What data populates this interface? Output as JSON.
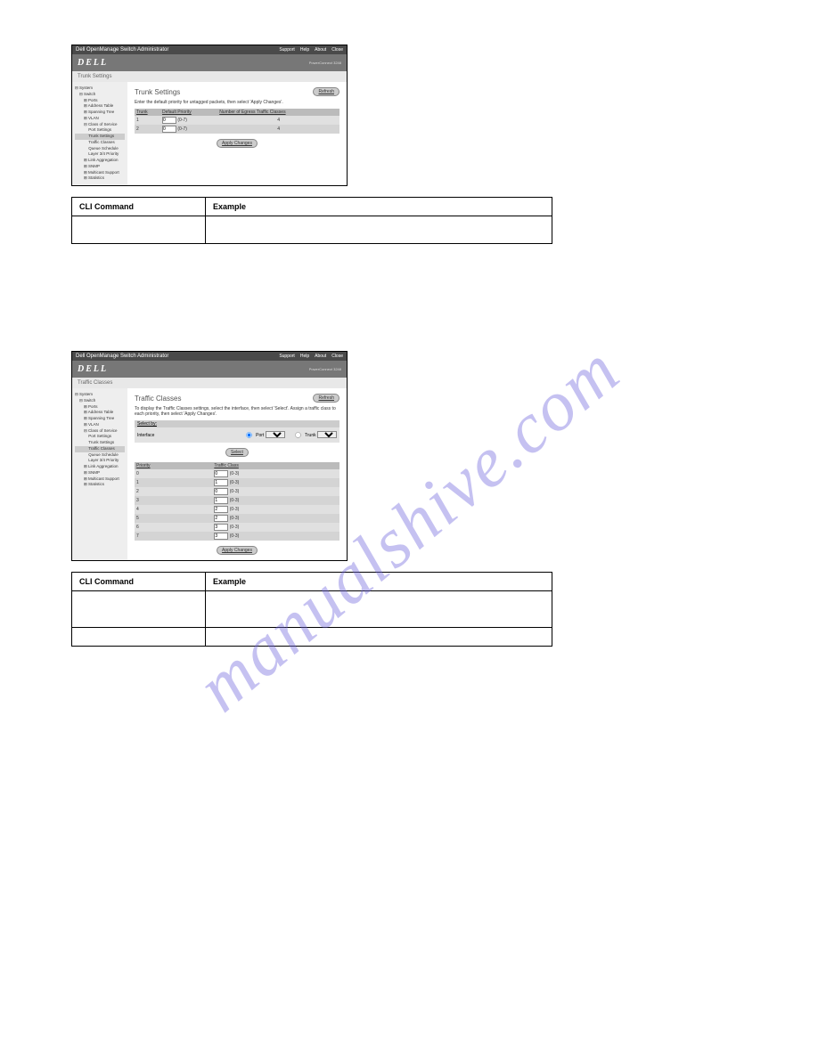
{
  "watermark": "manualshive.com",
  "titlebar": {
    "app": "Dell OpenManage Switch Administrator",
    "links": [
      "Support",
      "Help",
      "About",
      "Close"
    ]
  },
  "logobar": {
    "logo": "DELL",
    "model": "PowerConnect 3248"
  },
  "tree": {
    "nodes": [
      "System",
      "Switch",
      "Ports",
      "Address Table",
      "Spanning Tree",
      "VLAN",
      "Class of Service",
      "Port Settings",
      "Trunk Settings",
      "Traffic Classes",
      "Queue Schedule",
      "Layer 3/4 Priority",
      "Link Aggregation",
      "SNMP",
      "Multicast Support",
      "Statistics"
    ]
  },
  "trunk": {
    "breadcrumb": "Trunk Settings",
    "heading": "Trunk Settings",
    "refresh": "Refresh",
    "desc": "Enter the default priority for untagged packets, then select 'Apply Changes'.",
    "cols": [
      "Trunk",
      "Default Priority",
      "Number of Egress Traffic Classes"
    ],
    "rows": [
      {
        "trunk": "1",
        "prio": "0",
        "range": "(0-7)",
        "classes": "4"
      },
      {
        "trunk": "2",
        "prio": "0",
        "range": "(0-7)",
        "classes": "4"
      }
    ],
    "apply": "Apply Changes"
  },
  "cli1": {
    "header": [
      "CLI Command",
      "Example"
    ],
    "rows": [
      {
        "cmd": "",
        "ex": ""
      }
    ]
  },
  "traffic": {
    "breadcrumb": "Traffic Classes",
    "heading": "Traffic Classes",
    "refresh": "Refresh",
    "desc": "To display the Traffic Classes settings, select the interface, then select 'Select'. Assign a traffic class to each priority, then select 'Apply Changes'.",
    "selectby": "Select by:",
    "interface": "Interface",
    "portLabel": "Port",
    "trunkLabel": "Trunk",
    "selectBtn": "Select",
    "cols": [
      "Priority",
      "Traffic Class"
    ],
    "rows": [
      {
        "p": "0",
        "v": "0",
        "r": "(0-3)"
      },
      {
        "p": "1",
        "v": "1",
        "r": "(0-3)"
      },
      {
        "p": "2",
        "v": "0",
        "r": "(0-3)"
      },
      {
        "p": "3",
        "v": "1",
        "r": "(0-3)"
      },
      {
        "p": "4",
        "v": "2",
        "r": "(0-3)"
      },
      {
        "p": "5",
        "v": "2",
        "r": "(0-3)"
      },
      {
        "p": "6",
        "v": "3",
        "r": "(0-3)"
      },
      {
        "p": "7",
        "v": "3",
        "r": "(0-3)"
      }
    ],
    "apply": "Apply Changes"
  },
  "cli2": {
    "header": [
      "CLI Command",
      "Example"
    ],
    "rows": [
      {
        "cmd": "",
        "ex": ""
      },
      {
        "cmd": "",
        "ex": ""
      }
    ]
  }
}
